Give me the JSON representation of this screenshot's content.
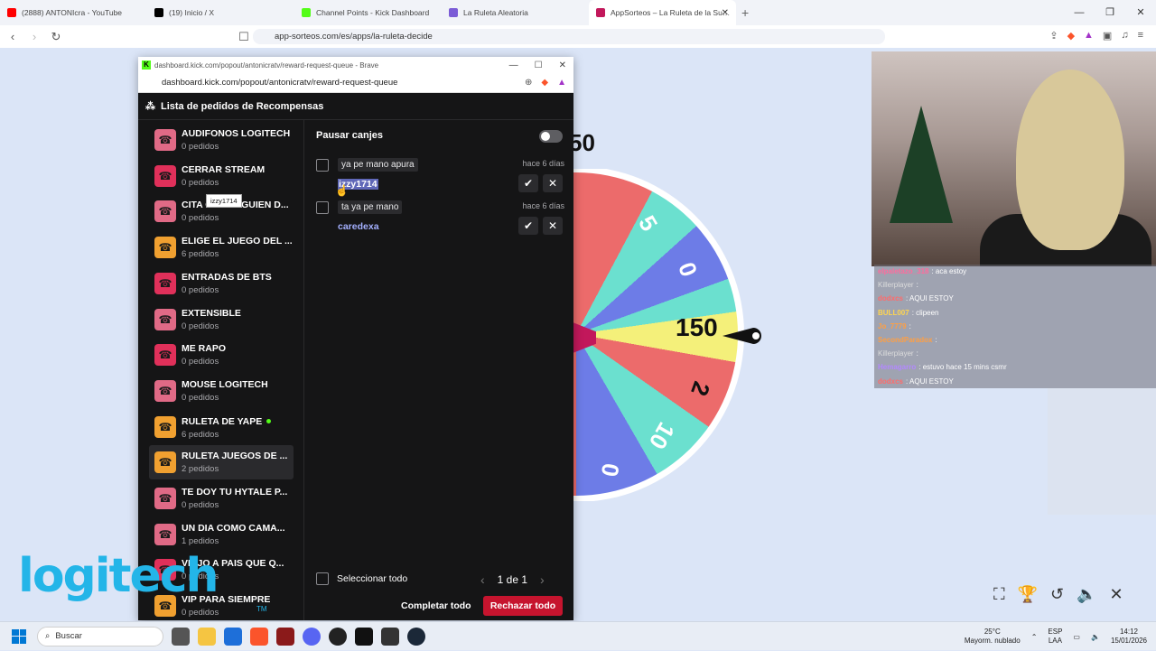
{
  "browser": {
    "tabs": [
      {
        "title": "(2888) ANTONIcra - YouTube",
        "color": "#ff0000"
      },
      {
        "title": "(19) Inicio / X",
        "color": "#000000"
      },
      {
        "title": "Channel Points - Kick Dashboard",
        "color": "#53fc18"
      },
      {
        "title": "La Ruleta Aleatoria",
        "color": "#7b5cd6"
      },
      {
        "title": "AppSorteos – La Ruleta de la Su…",
        "color": "#c2185b"
      }
    ],
    "url": "app-sorteos.com/es/apps/la-ruleta-decide"
  },
  "wheel": {
    "top_value": "50",
    "labels": [
      "5",
      "0",
      "150",
      "2",
      "10",
      "0"
    ],
    "selected": "150"
  },
  "popup": {
    "window_title": "dashboard.kick.com/popout/antonicratv/reward-request-queue - Brave",
    "url": "dashboard.kick.com/popout/antonicratv/reward-request-queue",
    "header": "Lista de pedidos de Recompensas",
    "rewards": [
      {
        "name": "AUDIFONOS LOGITECH",
        "count": "0 pedidos",
        "color": "#e06a86"
      },
      {
        "name": "CERRAR STREAM",
        "count": "0 pedidos",
        "color": "#e0305a"
      },
      {
        "name": "CITA CON ALGUIEN D...",
        "count": "0 pedidos",
        "color": "#e06a86"
      },
      {
        "name": "ELIGE EL JUEGO DEL ...",
        "count": "6 pedidos",
        "color": "#f0a030"
      },
      {
        "name": "ENTRADAS DE BTS",
        "count": "0 pedidos",
        "color": "#e0305a"
      },
      {
        "name": "EXTENSIBLE",
        "count": "0 pedidos",
        "color": "#e06a86"
      },
      {
        "name": "ME RAPO",
        "count": "0 pedidos",
        "color": "#e0305a"
      },
      {
        "name": "MOUSE LOGITECH",
        "count": "0 pedidos",
        "color": "#e06a86"
      },
      {
        "name": "RULETA DE YAPE",
        "count": "6 pedidos",
        "color": "#f0a030"
      },
      {
        "name": "RULETA JUEGOS DE ...",
        "count": "2 pedidos",
        "color": "#f0a030"
      },
      {
        "name": "TE DOY TU HYTALE P...",
        "count": "0 pedidos",
        "color": "#e06a86"
      },
      {
        "name": "UN DIA COMO CAMA...",
        "count": "1 pedidos",
        "color": "#e06a86"
      },
      {
        "name": "VIAJO A PAIS QUE Q...",
        "count": "0 pedidos",
        "color": "#e0305a"
      },
      {
        "name": "VIP PARA SIEMPRE",
        "count": "0 pedidos",
        "color": "#f0a030"
      }
    ],
    "pause_label": "Pausar canjes",
    "requests": [
      {
        "message": "ya pe mano apura",
        "user": "izzy1714",
        "time": "hace 6 días"
      },
      {
        "message": "ta ya pe mano",
        "user": "caredexa",
        "time": "hace 6 días"
      }
    ],
    "tooltip": "izzy1714",
    "select_all": "Seleccionar todo",
    "page": "1 de 1",
    "complete_all": "Completar todo",
    "reject_all": "Rechazar todo"
  },
  "chat": [
    {
      "user": "elpaletazo_318",
      "text": ": aca estoy",
      "color": "#ff6b9d"
    },
    {
      "user": "Killerplayer",
      "text": ":",
      "color": "#dddddd"
    },
    {
      "user": "dodxcs",
      "text": ": AQUI ESTOY",
      "color": "#ff6b6b"
    },
    {
      "user": "BULL007",
      "text": ": clipeen",
      "color": "#ffd54f"
    },
    {
      "user": "Jo_7779",
      "text": ":",
      "color": "#ff9f43"
    },
    {
      "user": "SecondParadox",
      "text": ":",
      "color": "#ff9f43"
    },
    {
      "user": "Killerplayer",
      "text": ":",
      "color": "#dddddd"
    },
    {
      "user": "Hemagarro",
      "text": ": estuvo hace 15 mins csmr",
      "color": "#b388ff"
    },
    {
      "user": "dodxcs",
      "text": ": AQUI ESTOY",
      "color": "#ff6b6b"
    }
  ],
  "overlay_logo": "logitech",
  "taskbar": {
    "search_placeholder": "Buscar",
    "weather_temp": "25°C",
    "weather_desc": "Mayorm. nublado",
    "lang_1": "ESP",
    "lang_2": "LAA",
    "time": "14:12",
    "date": "15/01/2026"
  }
}
